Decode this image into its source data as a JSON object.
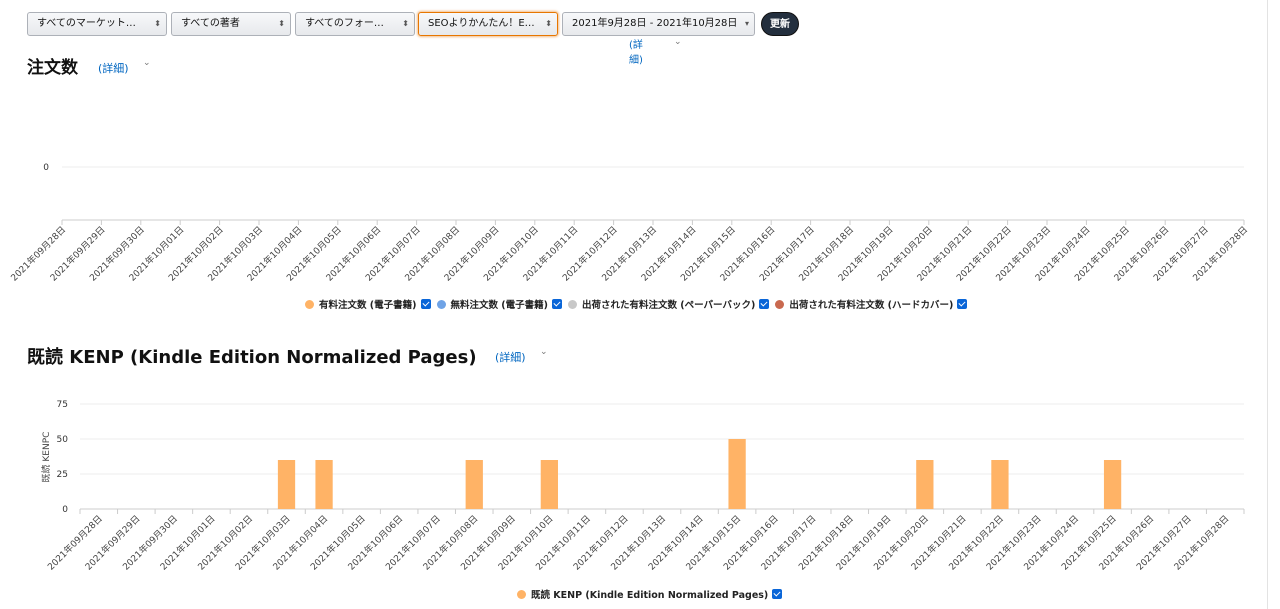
{
  "filters": {
    "marketplace": "すべてのマーケット…",
    "author": "すべての著者",
    "format": "すべてのフォー…",
    "title": "SEOよりかんたん！E…",
    "date_range": "2021年9月28日 - 2021年10月28日",
    "update_button": "更新",
    "detail_link": "(詳細)"
  },
  "orders_section": {
    "title": "注文数",
    "detail_link": "(詳細)",
    "legend": [
      {
        "label": "有料注文数 (電子書籍)",
        "color": "#ffb366",
        "checked": true
      },
      {
        "label": "無料注文数 (電子書籍)",
        "color": "#6fa3e6",
        "checked": true
      },
      {
        "label": "出荷された有料注文数 (ペーパーバック)",
        "color": "#c8c8c8",
        "checked": true
      },
      {
        "label": "出荷された有料注文数 (ハードカバー)",
        "color": "#c9694f",
        "checked": true
      }
    ]
  },
  "kenp_section": {
    "title": "既読 KENP (Kindle Edition Normalized Pages)",
    "detail_link": "(詳細)",
    "legend": [
      {
        "label": "既読 KENP (Kindle Edition Normalized Pages)",
        "color": "#ffb366",
        "checked": true
      }
    ]
  },
  "chart_data": [
    {
      "type": "bar",
      "title": "注文数",
      "categories": [
        "2021年09月28日",
        "2021年09月29日",
        "2021年09月30日",
        "2021年10月01日",
        "2021年10月02日",
        "2021年10月03日",
        "2021年10月04日",
        "2021年10月05日",
        "2021年10月06日",
        "2021年10月07日",
        "2021年10月08日",
        "2021年10月09日",
        "2021年10月10日",
        "2021年10月11日",
        "2021年10月12日",
        "2021年10月13日",
        "2021年10月14日",
        "2021年10月15日",
        "2021年10月16日",
        "2021年10月17日",
        "2021年10月18日",
        "2021年10月19日",
        "2021年10月20日",
        "2021年10月21日",
        "2021年10月22日",
        "2021年10月23日",
        "2021年10月24日",
        "2021年10月25日",
        "2021年10月26日",
        "2021年10月27日",
        "2021年10月28日"
      ],
      "series": [
        {
          "name": "有料注文数 (電子書籍)",
          "values": [
            0,
            0,
            0,
            0,
            0,
            0,
            0,
            0,
            0,
            0,
            0,
            0,
            0,
            0,
            0,
            0,
            0,
            0,
            0,
            0,
            0,
            0,
            0,
            0,
            0,
            0,
            0,
            0,
            0,
            0,
            0
          ]
        },
        {
          "name": "無料注文数 (電子書籍)",
          "values": [
            0,
            0,
            0,
            0,
            0,
            0,
            0,
            0,
            0,
            0,
            0,
            0,
            0,
            0,
            0,
            0,
            0,
            0,
            0,
            0,
            0,
            0,
            0,
            0,
            0,
            0,
            0,
            0,
            0,
            0,
            0
          ]
        },
        {
          "name": "出荷された有料注文数 (ペーパーバック)",
          "values": [
            0,
            0,
            0,
            0,
            0,
            0,
            0,
            0,
            0,
            0,
            0,
            0,
            0,
            0,
            0,
            0,
            0,
            0,
            0,
            0,
            0,
            0,
            0,
            0,
            0,
            0,
            0,
            0,
            0,
            0,
            0
          ]
        },
        {
          "name": "出荷された有料注文数 (ハードカバー)",
          "values": [
            0,
            0,
            0,
            0,
            0,
            0,
            0,
            0,
            0,
            0,
            0,
            0,
            0,
            0,
            0,
            0,
            0,
            0,
            0,
            0,
            0,
            0,
            0,
            0,
            0,
            0,
            0,
            0,
            0,
            0,
            0
          ]
        }
      ],
      "yticks": [
        "0"
      ],
      "xlabel": "",
      "ylabel": "",
      "legend_position": "bottom"
    },
    {
      "type": "bar",
      "title": "既読 KENP (Kindle Edition Normalized Pages)",
      "categories": [
        "2021年09月28日",
        "2021年09月29日",
        "2021年09月30日",
        "2021年10月01日",
        "2021年10月02日",
        "2021年10月03日",
        "2021年10月04日",
        "2021年10月05日",
        "2021年10月06日",
        "2021年10月07日",
        "2021年10月08日",
        "2021年10月09日",
        "2021年10月10日",
        "2021年10月11日",
        "2021年10月12日",
        "2021年10月13日",
        "2021年10月14日",
        "2021年10月15日",
        "2021年10月16日",
        "2021年10月17日",
        "2021年10月18日",
        "2021年10月19日",
        "2021年10月20日",
        "2021年10月21日",
        "2021年10月22日",
        "2021年10月23日",
        "2021年10月24日",
        "2021年10月25日",
        "2021年10月26日",
        "2021年10月27日",
        "2021年10月28日"
      ],
      "series": [
        {
          "name": "既読 KENP (Kindle Edition Normalized Pages)",
          "color": "#ffb366",
          "values": [
            0,
            0,
            0,
            0,
            0,
            35,
            35,
            0,
            0,
            0,
            35,
            0,
            35,
            0,
            0,
            0,
            0,
            50,
            0,
            0,
            0,
            0,
            35,
            0,
            35,
            0,
            0,
            35,
            0,
            0,
            0
          ]
        }
      ],
      "ylim": [
        0,
        75
      ],
      "yticks": [
        0,
        25,
        50,
        75
      ],
      "xlabel": "",
      "ylabel": "既読 KENPC",
      "grid": true,
      "legend_position": "bottom"
    }
  ]
}
